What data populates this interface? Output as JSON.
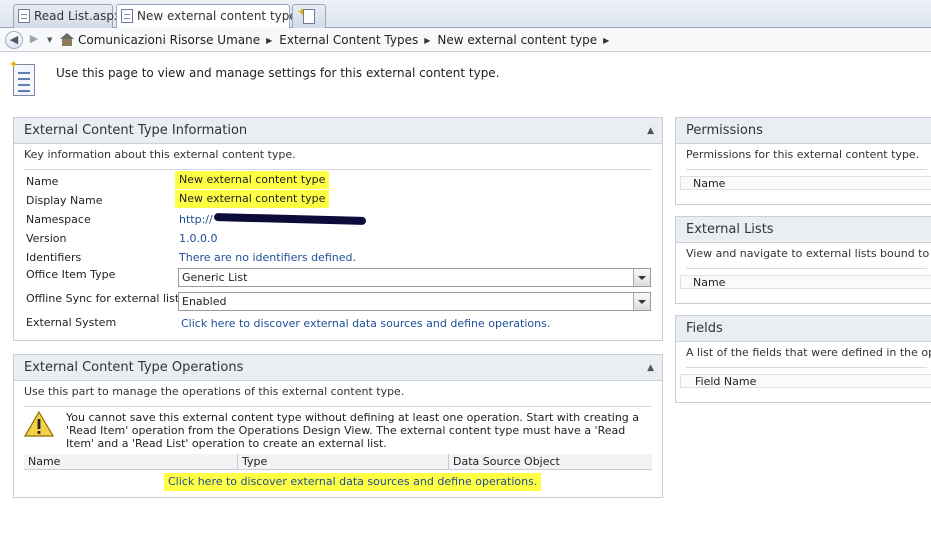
{
  "tabs": [
    {
      "label": "Read List.aspx"
    },
    {
      "label": "New external content type *"
    }
  ],
  "breadcrumb": {
    "items": [
      "Comunicazioni Risorse Umane",
      "External Content Types",
      "New external content type"
    ]
  },
  "intro": {
    "text": "Use this page to view and manage settings for this external content type."
  },
  "info_panel": {
    "title": "External Content Type Information",
    "description": "Key information about this external content type.",
    "fields": {
      "name_label": "Name",
      "name_value": "New external content type",
      "display_name_label": "Display Name",
      "display_name_value": "New external content type",
      "namespace_label": "Namespace",
      "namespace_value": "http://",
      "version_label": "Version",
      "version_value": "1.0.0.0",
      "identifiers_label": "Identifiers",
      "identifiers_value": "There are no identifiers defined.",
      "office_item_type_label": "Office Item Type",
      "office_item_type_value": "Generic List",
      "offline_sync_label": "Offline Sync for external list",
      "offline_sync_value": "Enabled",
      "external_system_label": "External System",
      "external_system_link": "Click here to discover external data sources and define operations."
    }
  },
  "operations_panel": {
    "title": "External Content Type Operations",
    "description": "Use this part to manage the operations of this external content type.",
    "warning": "You cannot save this external content type without defining at least one operation. Start with creating a 'Read Item' operation from the Operations Design View. The external content type must have a 'Read Item' and a 'Read List' operation to create an external list.",
    "columns": [
      "Name",
      "Type",
      "Data Source Object"
    ],
    "link": "Click here to discover external data sources and define operations."
  },
  "permissions_panel": {
    "title": "Permissions",
    "description": "Permissions for this external content type.",
    "column": "Name"
  },
  "external_lists_panel": {
    "title": "External Lists",
    "description": "View and navigate to external lists bound to thi",
    "column": "Name"
  },
  "fields_panel": {
    "title": "Fields",
    "description": "A list of the fields that were defined in the oper",
    "column": "Field Name"
  },
  "colors": {
    "highlight": "#ffff44",
    "link": "#1f4e99",
    "panel_header": "#eaedf1"
  }
}
